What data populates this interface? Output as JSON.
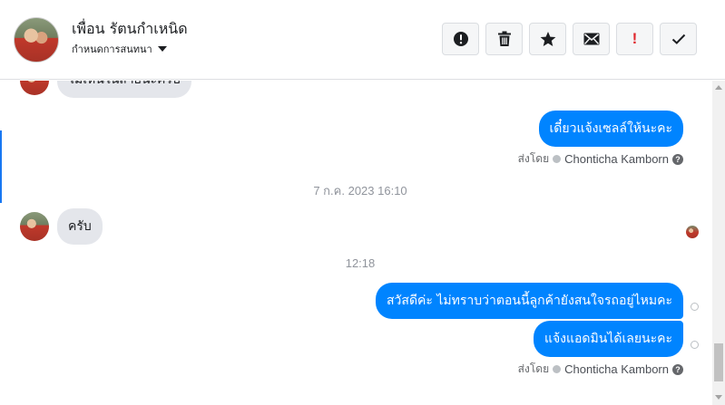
{
  "header": {
    "contact_name": "เพื่อน รัตนกำเหนิด",
    "label_select": "กำหนดการสนทนา",
    "actions": [
      {
        "icon": "exclamation-circle-icon"
      },
      {
        "icon": "trash-icon"
      },
      {
        "icon": "star-icon"
      },
      {
        "icon": "envelope-icon"
      },
      {
        "icon": "exclamation-icon",
        "text": "!"
      },
      {
        "icon": "checkmark-icon"
      }
    ]
  },
  "thread": {
    "msg_partial": "ไม่เห็นในสายนะครับ",
    "msg_out_1": "เดี๋ยวแจ้งเซลล์ให้นะคะ",
    "sent_by_1": {
      "prefix": "ส่งโดย",
      "name": "Chonticha Kamborn",
      "help": "?"
    },
    "timestamp_1": "7 ก.ค. 2023 16:10",
    "msg_in_1": "ครับ",
    "timestamp_2": "12:18",
    "msg_out_2": "สวัสดีค่ะ ไม่ทราบว่าตอนนี้ลูกค้ายังสนใจรถอยู่ไหมคะ",
    "msg_out_3": "แจ้งแอดมินได้เลยนะคะ",
    "sent_by_2": {
      "prefix": "ส่งโดย",
      "name": "Chonticha Kamborn",
      "help": "?"
    }
  },
  "colors": {
    "outgoing_bubble": "#0084ff",
    "incoming_bubble": "#e4e6eb",
    "accent": "#1877f2",
    "alert_red": "#e0282e"
  }
}
